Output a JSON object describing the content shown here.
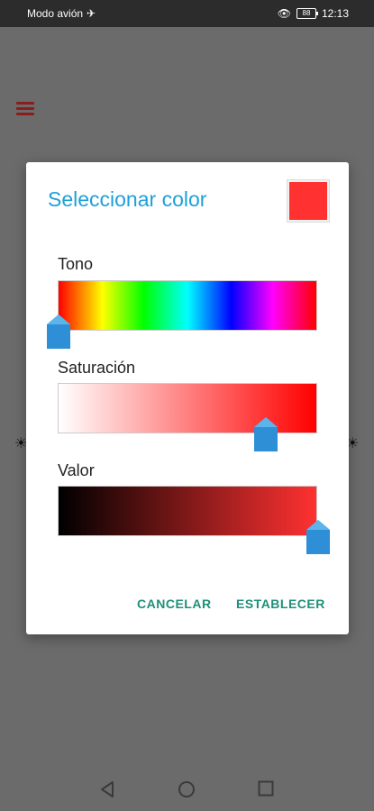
{
  "status_bar": {
    "left_text": "Modo avión",
    "battery_text": "88",
    "time": "12:13"
  },
  "dialog": {
    "title": "Seleccionar color",
    "preview_color": "#ff3131",
    "hue": {
      "label": "Tono",
      "value_fraction": 0.0
    },
    "saturation": {
      "label": "Saturación",
      "value_fraction": 0.8
    },
    "value": {
      "label": "Valor",
      "value_fraction": 1.0
    },
    "cancel_label": "CANCELAR",
    "set_label": "ESTABLECER"
  },
  "colors": {
    "accent_title": "#1ea0d9",
    "button_text": "#1f8f78",
    "thumb": "#2e8fd6"
  }
}
